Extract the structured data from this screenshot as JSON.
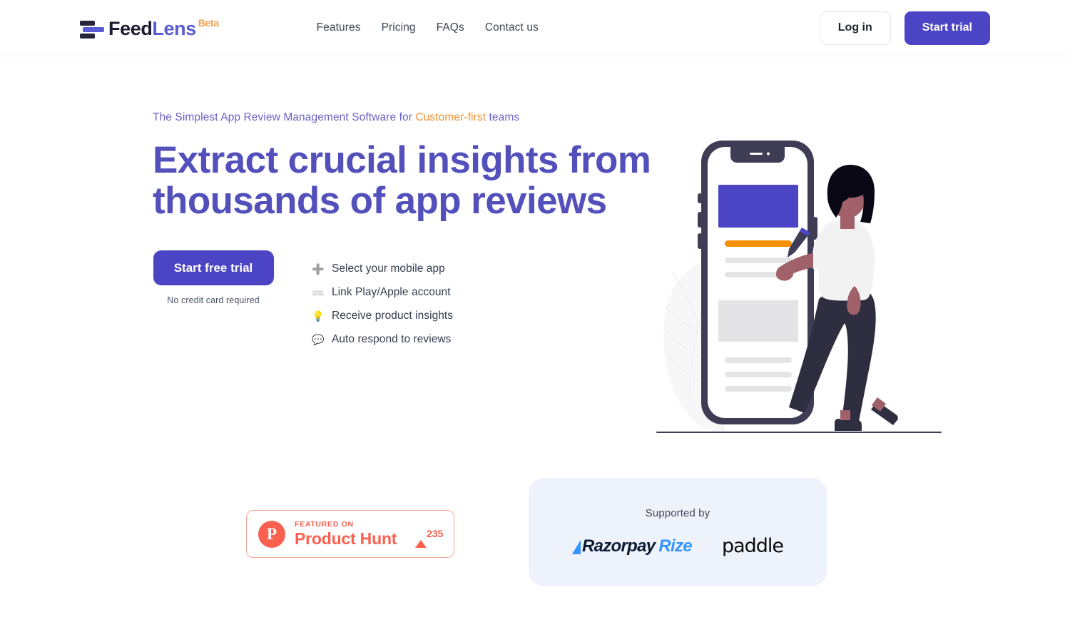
{
  "header": {
    "brand": {
      "name_first": "Feed",
      "name_second": "Lens",
      "badge": "Beta",
      "logo_icon": "feedlens-bars-logo"
    },
    "nav": [
      {
        "label": "Features"
      },
      {
        "label": "Pricing"
      },
      {
        "label": "FAQs"
      },
      {
        "label": "Contact us"
      }
    ],
    "login_label": "Log in",
    "trial_label": "Start trial"
  },
  "hero": {
    "eyebrow_before": "The Simplest App Review Management Software for ",
    "eyebrow_highlight": "Customer-first",
    "eyebrow_after": " teams",
    "headline": "Extract crucial insights from thousands of app reviews",
    "cta_label": "Start free trial",
    "cta_note": "No credit card required",
    "features": [
      {
        "icon": "heavy-plus-icon",
        "glyph": "➕",
        "label": "Select your mobile app"
      },
      {
        "icon": "keyboard-icon",
        "glyph": "⌨️",
        "label": "Link Play/Apple account"
      },
      {
        "icon": "light-bulb-icon",
        "glyph": "💡",
        "label": "Receive product insights"
      },
      {
        "icon": "speech-balloon-icon",
        "glyph": "💬",
        "label": "Auto respond to reviews"
      }
    ],
    "illustration": "woman-with-phone-illustration"
  },
  "product_hunt": {
    "logo_letter": "P",
    "featured_label": "FEATURED ON",
    "name": "Product Hunt",
    "upvotes": "235",
    "accent_color": "#f9604f"
  },
  "supported": {
    "label": "Supported by",
    "logos": [
      {
        "name": "razorpay-rize-logo",
        "part_one": "Razorpay",
        "part_two": "Rize"
      },
      {
        "name": "paddle-logo",
        "text": "paddle"
      }
    ]
  },
  "colors": {
    "brand_purple": "#4b45c6",
    "headline_purple": "#5350bb",
    "accent_orange": "#f09233",
    "product_hunt_red": "#f9604f",
    "panel_blue": "#eef2fb"
  }
}
